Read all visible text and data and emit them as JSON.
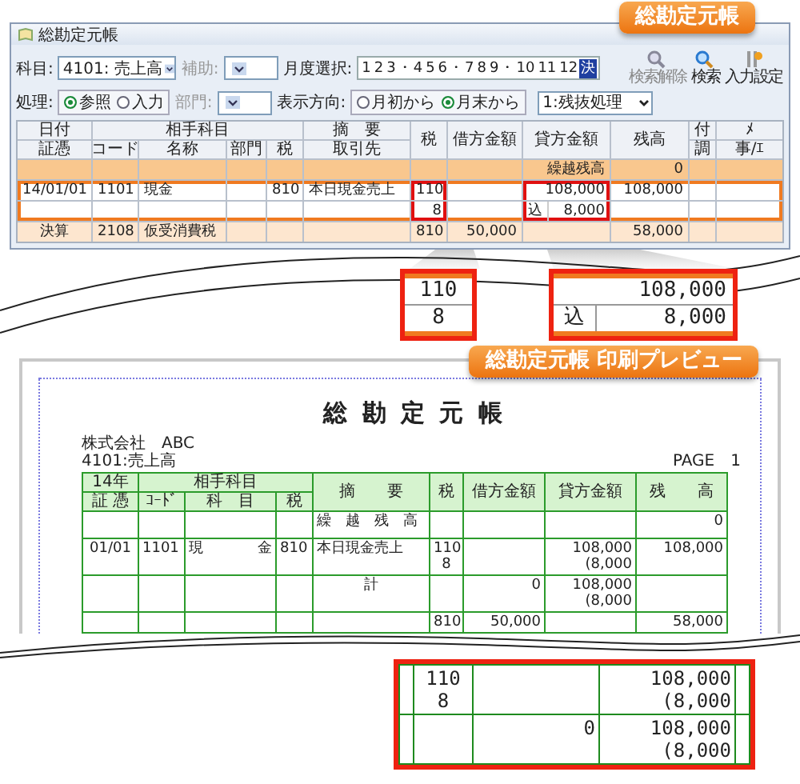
{
  "window": {
    "title": "総勘定元帳",
    "badge": "総勘定元帳"
  },
  "toolbar": {
    "rows": [
      [
        {
          "kind": "select",
          "label": "科目:",
          "value": "4101: 売上高",
          "disabled": false
        },
        {
          "kind": "select",
          "label": "補助:",
          "disabled": true
        },
        {
          "kind": "months",
          "label": "月度選択:",
          "months": [
            {
              "kind": "month",
              "text": "1",
              "selected": false
            },
            {
              "kind": "month",
              "text": "2",
              "selected": false
            },
            {
              "kind": "month",
              "text": "3",
              "selected": false
            },
            {
              "kind": "sep",
              "text": "・"
            },
            {
              "kind": "month",
              "text": "4",
              "selected": false
            },
            {
              "kind": "month",
              "text": "5",
              "selected": false
            },
            {
              "kind": "month",
              "text": "6",
              "selected": false
            },
            {
              "kind": "sep",
              "text": "・"
            },
            {
              "kind": "month",
              "text": "7",
              "selected": false
            },
            {
              "kind": "month",
              "text": "8",
              "selected": false
            },
            {
              "kind": "month",
              "text": "9",
              "selected": false
            },
            {
              "kind": "sep",
              "text": "・"
            },
            {
              "kind": "month",
              "text": "10",
              "selected": false
            },
            {
              "kind": "month",
              "text": "11",
              "selected": false
            },
            {
              "kind": "month",
              "text": "12",
              "selected": false
            },
            {
              "kind": "month",
              "text": "決",
              "selected": true
            }
          ]
        }
      ],
      [
        {
          "kind": "radio",
          "label": "処理:",
          "options": [
            {
              "label": "参照",
              "selected": true
            },
            {
              "label": "入力",
              "selected": false
            }
          ]
        },
        {
          "kind": "select",
          "label": "部門:",
          "disabled": true
        },
        {
          "kind": "radio",
          "label": "表示方向:",
          "options": [
            {
              "label": "月初から",
              "selected": false
            },
            {
              "label": "月末から",
              "selected": true
            }
          ]
        },
        {
          "kind": "dropdown",
          "value": "1:残抜処理"
        }
      ]
    ],
    "buttons": [
      {
        "kind": "clear",
        "label": "検索解除",
        "disabled": true
      },
      {
        "kind": "search",
        "label": "検索",
        "disabled": false
      },
      {
        "kind": "settings",
        "label": "入力設定",
        "disabled": false
      }
    ]
  },
  "ledger": {
    "columns": [
      {
        "label": "日付",
        "sub": "証憑"
      },
      {
        "label": "相手科目",
        "subs": [
          "コード",
          "名称",
          "部門",
          "税"
        ]
      },
      {
        "label": "摘　要",
        "sub": "取引先"
      },
      {
        "label": "税"
      },
      {
        "label": "借方金額"
      },
      {
        "label": "貸方金額"
      },
      {
        "label": "残高"
      },
      {
        "label": "付",
        "sub": "調"
      },
      {
        "label": "ﾒ",
        "sub": "事/ｴ"
      }
    ],
    "rows": [
      {
        "kind": "carry",
        "selected": false,
        "lines": [
          {
            "credit": "繰越残高",
            "balance": "0"
          }
        ]
      },
      {
        "kind": "entry",
        "selected": true,
        "lines": [
          {
            "date": "14/01/01",
            "code": "1101",
            "account": "現金",
            "tax_code": "810",
            "description": "本日現金売上",
            "tax": {
              "text": "110",
              "zoomed": true
            },
            "credit": {
              "text": "108,000",
              "zoomed": true
            },
            "balance": "108,000"
          },
          {
            "tax": {
              "text": "8",
              "zoomed": true
            },
            "credit": {
              "mark": "込",
              "text": "8,000",
              "zoomed": true
            }
          }
        ]
      },
      {
        "kind": "closing",
        "selected": false,
        "lines": [
          {
            "date": "決算",
            "code": "2108",
            "account": "仮受消費税",
            "tax": "810",
            "debit": "50,000",
            "balance": "58,000"
          }
        ]
      }
    ]
  },
  "zoom_callouts": [
    {
      "rows": [
        {
          "value": "110"
        },
        {
          "value": "8"
        }
      ]
    },
    {
      "rows": [
        {
          "value": "108,000"
        },
        {
          "mark": "込",
          "value": "8,000"
        }
      ]
    }
  ],
  "preview": {
    "badge": "総勘定元帳 印刷プレビュー",
    "title": "総 勘 定 元 帳",
    "company": "株式会社　ABC",
    "account": "4101:売上高",
    "page_label": "PAGE",
    "page_number": "1",
    "columns": [
      {
        "label": "14年",
        "sub": "証 憑"
      },
      {
        "label": "相手科目",
        "subs": [
          "ｺｰﾄﾞ",
          "科　目",
          "税"
        ]
      },
      {
        "label": "摘　　要"
      },
      {
        "label": "税"
      },
      {
        "label": "借方金額"
      },
      {
        "label": "貸方金額"
      },
      {
        "label": "残　　高"
      }
    ],
    "rows": [
      {
        "kind": "carry",
        "cells": {
          "description": "繰　越　残　高",
          "balance": "0"
        }
      },
      {
        "kind": "entry",
        "cells": {
          "voucher": "01/01",
          "code": "1101",
          "account": "現金",
          "tax_code": "810",
          "description": "本日現金売上",
          "tax": [
            "110",
            "8"
          ],
          "credit": [
            "108,000",
            "(8,000"
          ],
          "balance": "108,000"
        }
      },
      {
        "kind": "total",
        "cells": {
          "description": "計",
          "debit": "0",
          "credit": [
            "108,000",
            "(8,000"
          ]
        }
      },
      {
        "kind": "partial",
        "cells": {
          "tax": "810",
          "debit": "50,000",
          "balance": "58,000"
        }
      }
    ]
  },
  "preview_callout": {
    "rows": [
      {
        "tax": [
          "110",
          "8"
        ],
        "credit": [
          "108,000",
          "(8,000"
        ]
      },
      {
        "debit": "0",
        "credit": [
          "108,000",
          "(8,000"
        ]
      }
    ]
  }
}
